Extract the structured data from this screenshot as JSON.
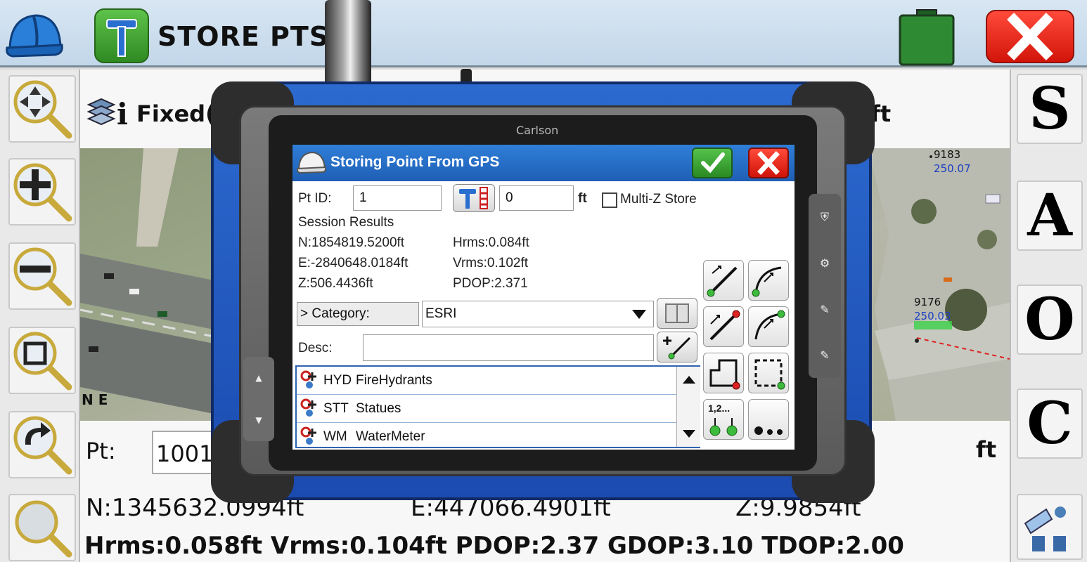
{
  "background_app": {
    "title": "STORE PTS",
    "fixed_label": "Fixed(",
    "top_unit": "ft",
    "right_buttons": [
      "S",
      "A",
      "O",
      "C"
    ],
    "map_labels": [
      {
        "id": "9183",
        "elev": "250.07"
      },
      {
        "id": "9176",
        "elev": "250.03"
      }
    ],
    "map_north_label": "N E",
    "pt_label": "Pt:",
    "pt_value": "1001",
    "bottom_unit": "ft",
    "northing": "N:1345632.0994ft",
    "easting": "E:447066.4901ft",
    "elevation": "Z:9.9854ft",
    "precision_line": "Hrms:0.058ft Vrms:0.104ft PDOP:2.37 GDOP:3.10 TDOP:2.00"
  },
  "tablet": {
    "brand": "Carlson",
    "left_keys": [
      "▲",
      "▼"
    ]
  },
  "dialog": {
    "title": "Storing Point From GPS",
    "pt_id_label": "Pt ID:",
    "pt_id_value": "1",
    "height_value": "0",
    "height_unit": "ft",
    "multi_z_label": "Multi-Z Store",
    "session_label": "Session Results",
    "n_value": "N:1854819.5200ft",
    "e_value": "E:-2840648.0184ft",
    "z_value": "Z:506.4436ft",
    "hrms_value": "Hrms:0.084ft",
    "vrms_value": "Vrms:0.102ft",
    "pdop_value": "PDOP:2.371",
    "category_label": "> Category:",
    "category_value": "ESRI",
    "desc_label": "Desc:",
    "desc_value": "",
    "features": [
      {
        "code": "HYD",
        "name": "FireHydrants"
      },
      {
        "code": "STT",
        "name": "Statues"
      },
      {
        "code": "WM",
        "name": "WaterMeter"
      }
    ],
    "points_tool_label": "1,2..."
  },
  "colors": {
    "header_blue": "#1f5fb5",
    "ok_green": "#2a8a22",
    "cancel_red": "#cf1409",
    "tablet_blue": "#1b4bb0"
  }
}
